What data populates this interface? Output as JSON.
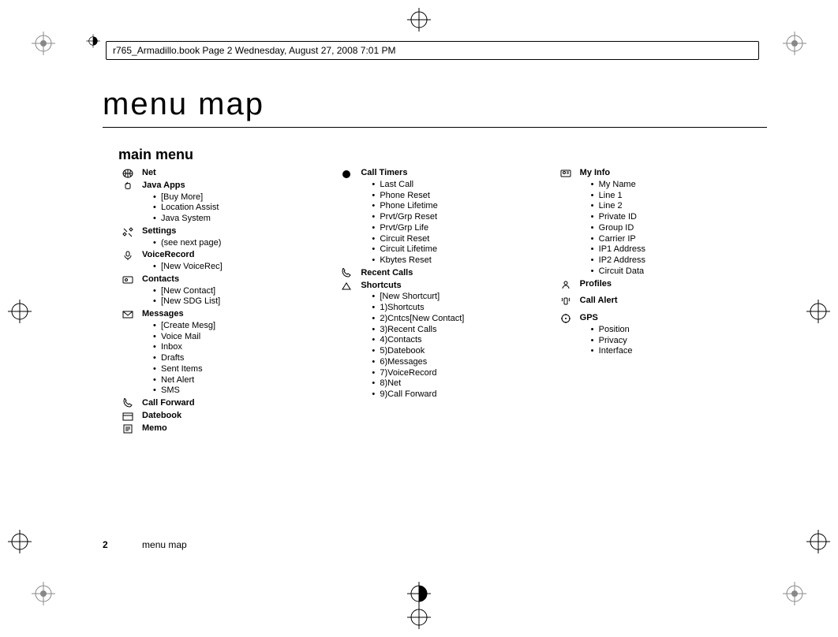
{
  "doc_header": "r765_Armadillo.book  Page 2  Wednesday, August 27, 2008  7:01 PM",
  "title": "menu map",
  "main_menu_heading": "main menu",
  "footer": {
    "page_number": "2",
    "label": "menu map"
  },
  "col1": {
    "net": {
      "title": "Net"
    },
    "java_apps": {
      "title": "Java Apps",
      "items": [
        "[Buy More]",
        "Location Assist",
        "Java System"
      ]
    },
    "settings": {
      "title": "Settings",
      "items": [
        "(see next page)"
      ]
    },
    "voicerecord": {
      "title": "VoiceRecord",
      "items": [
        "[New VoiceRec]"
      ]
    },
    "contacts": {
      "title": "Contacts",
      "items": [
        "[New Contact]",
        "[New SDG List]"
      ]
    },
    "messages": {
      "title": "Messages",
      "items": [
        "[Create Mesg]",
        "Voice Mail",
        "Inbox",
        "Drafts",
        "Sent Items",
        "Net Alert",
        "SMS"
      ]
    },
    "call_forward": {
      "title": "Call Forward"
    },
    "datebook": {
      "title": "Datebook"
    },
    "memo": {
      "title": "Memo"
    }
  },
  "col2": {
    "call_timers": {
      "title": "Call Timers",
      "items": [
        "Last Call",
        "Phone Reset",
        "Phone Lifetime",
        "Prvt/Grp Reset",
        "Prvt/Grp Life",
        "Circuit Reset",
        "Circuit Lifetime",
        "Kbytes Reset"
      ]
    },
    "recent_calls": {
      "title": "Recent Calls"
    },
    "shortcuts": {
      "title": "Shortcuts",
      "items": [
        "[New Shortcurt]",
        "1)Shortcuts",
        "2)Cntcs[New Contact]",
        "3)Recent Calls",
        "4)Contacts",
        "5)Datebook",
        "6)Messages",
        "7)VoiceRecord",
        "8)Net",
        "9)Call Forward"
      ]
    }
  },
  "col3": {
    "my_info": {
      "title": "My Info",
      "items": [
        "My Name",
        "Line 1",
        "Line 2",
        "Private ID",
        "Group ID",
        "Carrier IP",
        "IP1 Address",
        "IP2 Address",
        "Circuit Data"
      ]
    },
    "profiles": {
      "title": "Profiles"
    },
    "call_alert": {
      "title": "Call Alert"
    },
    "gps": {
      "title": "GPS",
      "items": [
        "Position",
        "Privacy",
        "Interface"
      ]
    }
  }
}
